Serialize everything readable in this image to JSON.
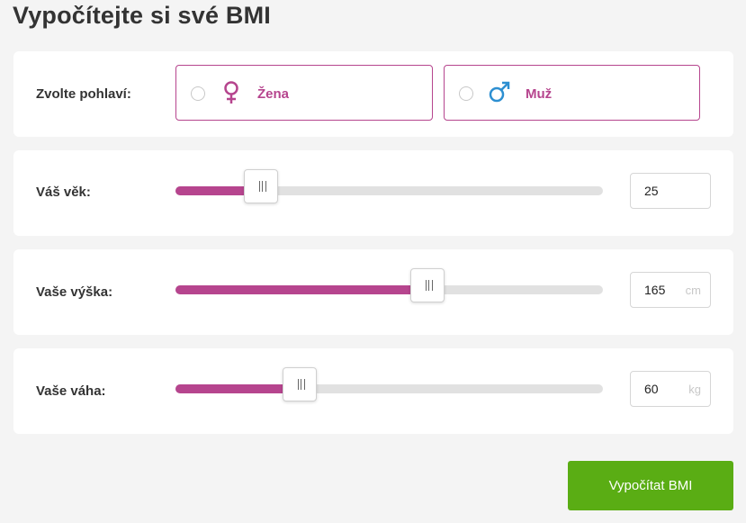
{
  "page_title": "Vypočítejte si své BMI",
  "gender": {
    "label": "Zvolte pohlaví:",
    "options": [
      {
        "label": "Žena",
        "icon": "female-symbol-icon",
        "color": "#b6458e"
      },
      {
        "label": "Muž",
        "icon": "male-symbol-icon",
        "color": "#2d8fd1"
      }
    ]
  },
  "age": {
    "label": "Váš věk:",
    "value": "25",
    "unit": "",
    "min": 0,
    "max": 100,
    "fraction": 0.2
  },
  "height": {
    "label": "Vaše výška:",
    "value": "165",
    "unit": "cm",
    "fraction": 0.59
  },
  "weight": {
    "label": "Vaše váha:",
    "value": "60",
    "unit": "kg",
    "fraction": 0.29
  },
  "calculate_button": "Vypočítat BMI",
  "colors": {
    "accent": "#b6458e",
    "button": "#5aad14",
    "male": "#2d8fd1"
  }
}
